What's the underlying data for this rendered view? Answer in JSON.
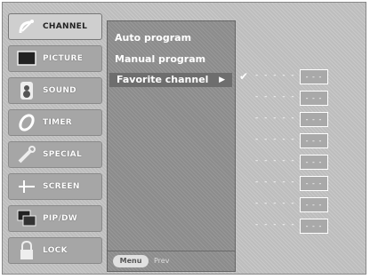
{
  "sidebar": {
    "items": [
      {
        "label": "CHANNEL",
        "icon": "satellite-dish-icon",
        "active": true
      },
      {
        "label": "PICTURE",
        "icon": "tv-screen-icon",
        "active": false
      },
      {
        "label": "SOUND",
        "icon": "speaker-icon",
        "active": false
      },
      {
        "label": "TIMER",
        "icon": "clock-icon",
        "active": false
      },
      {
        "label": "SPECIAL",
        "icon": "tools-icon",
        "active": false
      },
      {
        "label": "SCREEN",
        "icon": "crosshair-icon",
        "active": false
      },
      {
        "label": "PIP/DW",
        "icon": "pip-windows-icon",
        "active": false
      },
      {
        "label": "LOCK",
        "icon": "padlock-icon",
        "active": false
      }
    ]
  },
  "menu": {
    "items": [
      {
        "label": "Auto program"
      },
      {
        "label": "Manual program"
      },
      {
        "label": "Favorite channel",
        "arrow": "▶"
      }
    ],
    "footer": {
      "menu_button": "Menu",
      "prev_label": "Prev"
    }
  },
  "favorites": {
    "rows": [
      {
        "checked": "✔",
        "dashes": "- - - - -",
        "box": "- - -"
      },
      {
        "checked": "",
        "dashes": "- - - - -",
        "box": "- - -"
      },
      {
        "checked": "",
        "dashes": "- - - - -",
        "box": "- - -"
      },
      {
        "checked": "",
        "dashes": "- - - - -",
        "box": "- - -"
      },
      {
        "checked": "",
        "dashes": "- - - - -",
        "box": "- - -"
      },
      {
        "checked": "",
        "dashes": "- - - - -",
        "box": "- - -"
      },
      {
        "checked": "",
        "dashes": "- - - - -",
        "box": "- - -"
      },
      {
        "checked": "",
        "dashes": "- - - - -",
        "box": "- - -"
      }
    ]
  }
}
